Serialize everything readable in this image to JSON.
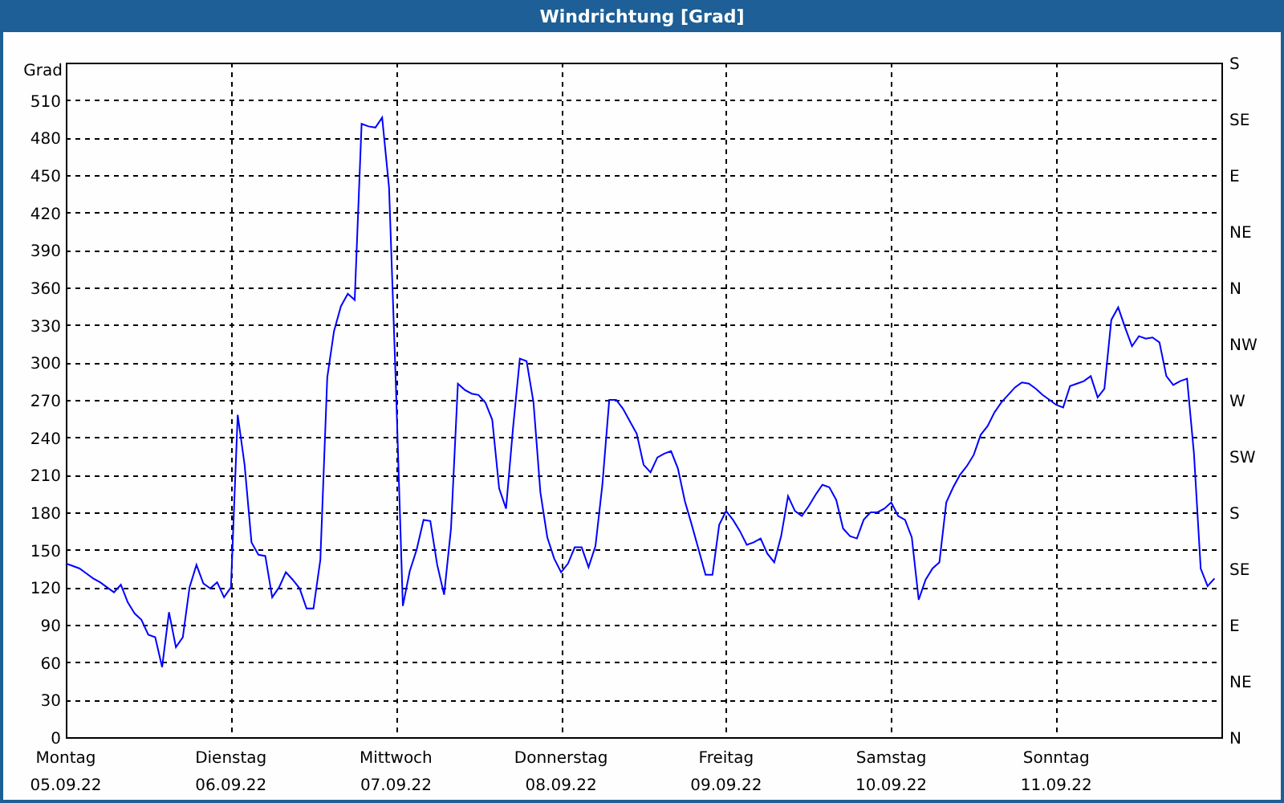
{
  "window": {
    "title": "Windrichtung [Grad]"
  },
  "chart": {
    "date_labels": [
      "05.09.22",
      "06.09.22",
      "07.09.22",
      "08.09.22",
      "09.09.22",
      "10.09.22",
      "11.09.22"
    ],
    "right_axis_labels": [
      "S",
      "SE",
      "E",
      "NE",
      "N",
      "NW",
      "W",
      "SW",
      "S",
      "SE",
      "E",
      "NE",
      "N"
    ],
    "chart_data": {
      "type": "line",
      "grid": true,
      "ylabel": "Grad",
      "categories": [
        "Montag",
        null,
        null,
        null,
        null,
        null,
        null,
        null,
        null,
        null,
        null,
        null,
        null,
        null,
        null,
        null,
        null,
        null,
        null,
        null,
        null,
        null,
        null,
        null,
        "Dienstag",
        null,
        null,
        null,
        null,
        null,
        null,
        null,
        null,
        null,
        null,
        null,
        null,
        null,
        null,
        null,
        null,
        null,
        null,
        null,
        null,
        null,
        null,
        null,
        "Mittwoch",
        null,
        null,
        null,
        null,
        null,
        null,
        null,
        null,
        null,
        null,
        null,
        null,
        null,
        null,
        null,
        null,
        null,
        null,
        null,
        null,
        null,
        null,
        null,
        "Donnerstag",
        null,
        null,
        null,
        null,
        null,
        null,
        null,
        null,
        null,
        null,
        null,
        null,
        null,
        null,
        null,
        null,
        null,
        null,
        null,
        null,
        null,
        null,
        null,
        "Freitag",
        null,
        null,
        null,
        null,
        null,
        null,
        null,
        null,
        null,
        null,
        null,
        null,
        null,
        null,
        null,
        null,
        null,
        null,
        null,
        null,
        null,
        null,
        null,
        "Samstag",
        null,
        null,
        null,
        null,
        null,
        null,
        null,
        null,
        null,
        null,
        null,
        null,
        null,
        null,
        null,
        null,
        null,
        null,
        null,
        null,
        null,
        null,
        null,
        "Sonntag",
        null,
        null,
        null,
        null,
        null,
        null,
        null,
        null,
        null,
        null,
        null,
        null,
        null,
        null,
        null,
        null,
        null,
        null,
        null,
        null,
        null,
        null,
        null,
        null
      ],
      "series": [
        {
          "color": "#0000ff",
          "values": [
            139,
            137,
            135,
            131,
            127,
            124,
            120,
            116,
            122,
            108,
            99,
            94,
            82,
            80,
            56,
            100,
            72,
            80,
            120,
            138,
            123,
            119,
            124,
            112,
            120,
            258,
            218,
            156,
            146,
            145,
            112,
            120,
            132,
            126,
            119,
            103,
            103,
            142,
            288,
            325,
            345,
            355,
            350,
            491,
            489,
            488,
            496,
            440,
            280,
            105,
            133,
            150,
            174,
            173,
            138,
            114,
            167,
            283,
            278,
            275,
            274,
            268,
            254,
            199,
            183,
            247,
            303,
            301,
            268,
            196,
            160,
            143,
            132,
            139,
            152,
            152,
            136,
            153,
            202,
            270,
            270,
            263,
            253,
            243,
            218,
            212,
            224,
            227,
            229,
            215,
            189,
            170,
            150,
            130,
            130,
            170,
            181,
            174,
            165,
            154,
            156,
            159,
            147,
            140,
            161,
            193,
            181,
            177,
            185,
            194,
            202,
            200,
            190,
            167,
            161,
            159,
            174,
            180,
            180,
            183,
            188,
            177,
            174,
            160,
            110,
            126,
            135,
            140,
            188,
            200,
            210,
            217,
            226,
            242,
            249,
            260,
            268,
            274,
            280,
            284,
            283,
            279,
            274,
            270,
            266,
            264,
            281,
            283,
            285,
            289,
            272,
            279,
            334,
            344,
            328,
            313,
            321,
            319,
            320,
            316,
            289,
            282,
            285,
            287,
            227,
            135,
            121,
            127,
            null
          ]
        }
      ],
      "ylim": [
        0,
        540
      ],
      "yticks": [
        0,
        30,
        60,
        90,
        120,
        150,
        180,
        210,
        240,
        270,
        300,
        330,
        360,
        390,
        420,
        450,
        480,
        510
      ]
    }
  }
}
